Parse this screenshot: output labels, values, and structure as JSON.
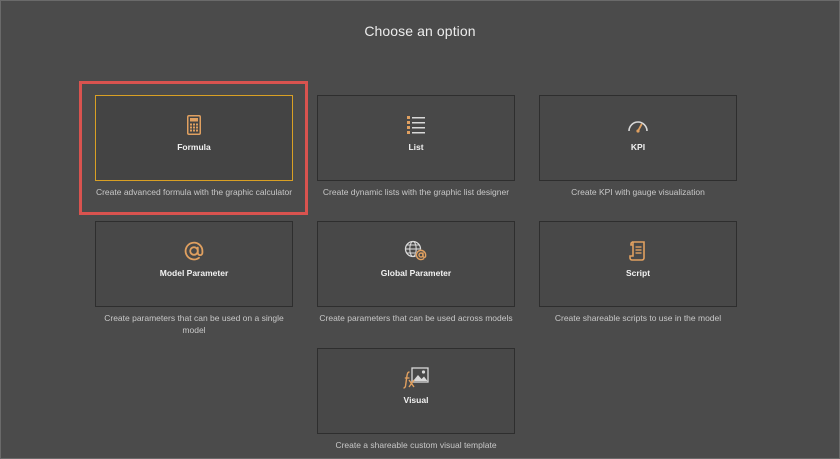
{
  "page": {
    "title": "Choose an option"
  },
  "colors": {
    "background": "#4b4b4b",
    "tile_background": "#484848",
    "selected_border": "#d9a024",
    "highlight_border": "#d9534f",
    "icon_accent": "#e0a060"
  },
  "options": [
    {
      "label": "Formula",
      "description": "Create advanced formula with the graphic calculator",
      "icon": "calculator-icon",
      "selected": true
    },
    {
      "label": "List",
      "description": "Create dynamic lists with the graphic list designer",
      "icon": "list-icon",
      "selected": false
    },
    {
      "label": "KPI",
      "description": "Create KPI with gauge visualization",
      "icon": "gauge-icon",
      "selected": false
    },
    {
      "label": "Model Parameter",
      "description": "Create parameters that can be used on a single model",
      "icon": "at-sign-icon",
      "selected": false
    },
    {
      "label": "Global Parameter",
      "description": "Create parameters that can be used across models",
      "icon": "globe-at-icon",
      "selected": false
    },
    {
      "label": "Script",
      "description": "Create shareable scripts to use in the model",
      "icon": "scroll-icon",
      "selected": false
    },
    {
      "label": "Visual",
      "description": "Create a shareable custom visual template",
      "icon": "fx-image-icon",
      "selected": false
    }
  ]
}
